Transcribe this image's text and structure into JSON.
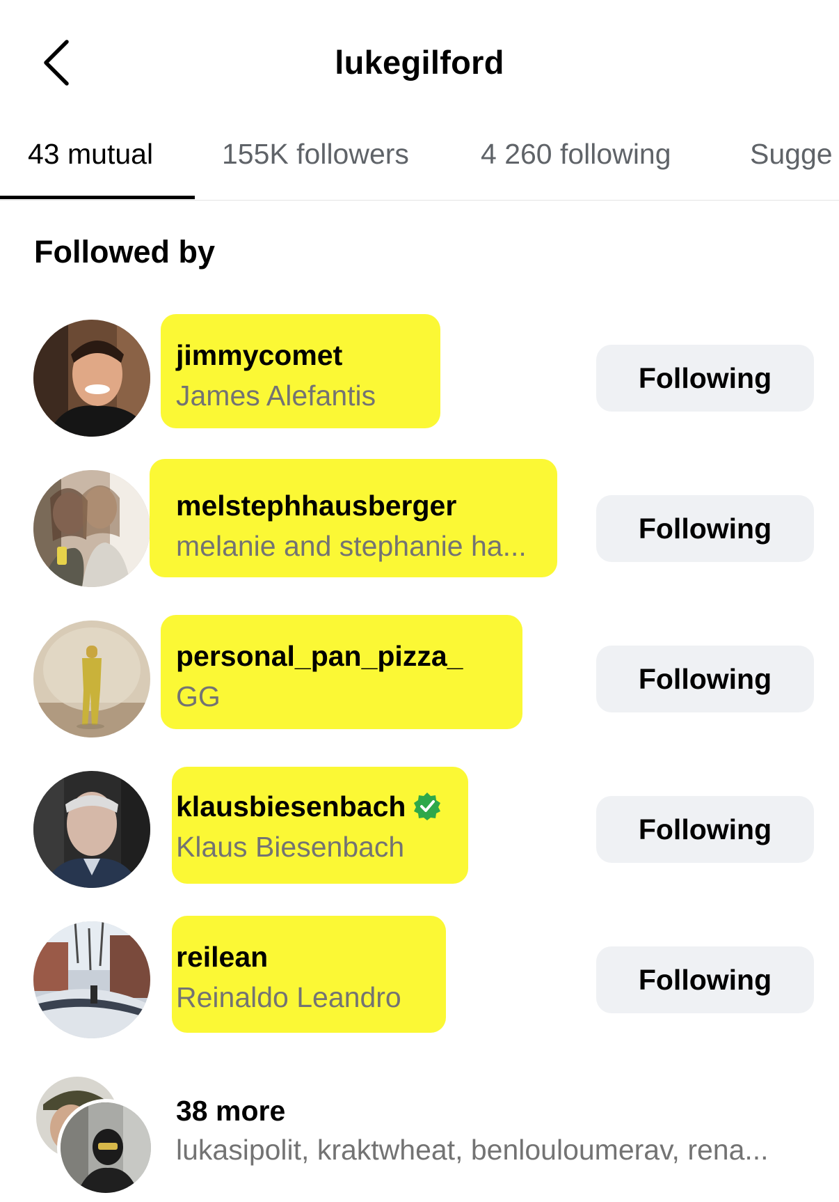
{
  "header": {
    "title": "lukegilford"
  },
  "tabs": [
    {
      "label": "43 mutual",
      "active": true
    },
    {
      "label": "155K followers",
      "active": false
    },
    {
      "label": "4 260 following",
      "active": false
    },
    {
      "label": "Sugge",
      "active": false
    }
  ],
  "section": {
    "heading": "Followed by"
  },
  "users": [
    {
      "username": "jimmycomet",
      "full_name": "James Alefantis",
      "button": "Following",
      "verified": false
    },
    {
      "username": "melstephhausberger",
      "full_name": "melanie and stephanie ha...",
      "button": "Following",
      "verified": false
    },
    {
      "username": "personal_pan_pizza_",
      "full_name": "GG",
      "button": "Following",
      "verified": false
    },
    {
      "username": "klausbiesenbach",
      "full_name": "Klaus Biesenbach",
      "button": "Following",
      "verified": true
    },
    {
      "username": "reilean",
      "full_name": "Reinaldo Leandro",
      "button": "Following",
      "verified": false
    }
  ],
  "more": {
    "title": "38 more",
    "names": "lukasipolit, kraktwheat, benlouloumerav, rena..."
  },
  "colors": {
    "highlight": "#fbf82a",
    "button_bg": "#eff1f4",
    "secondary_text": "#737373",
    "verified": "#2ea84a"
  }
}
